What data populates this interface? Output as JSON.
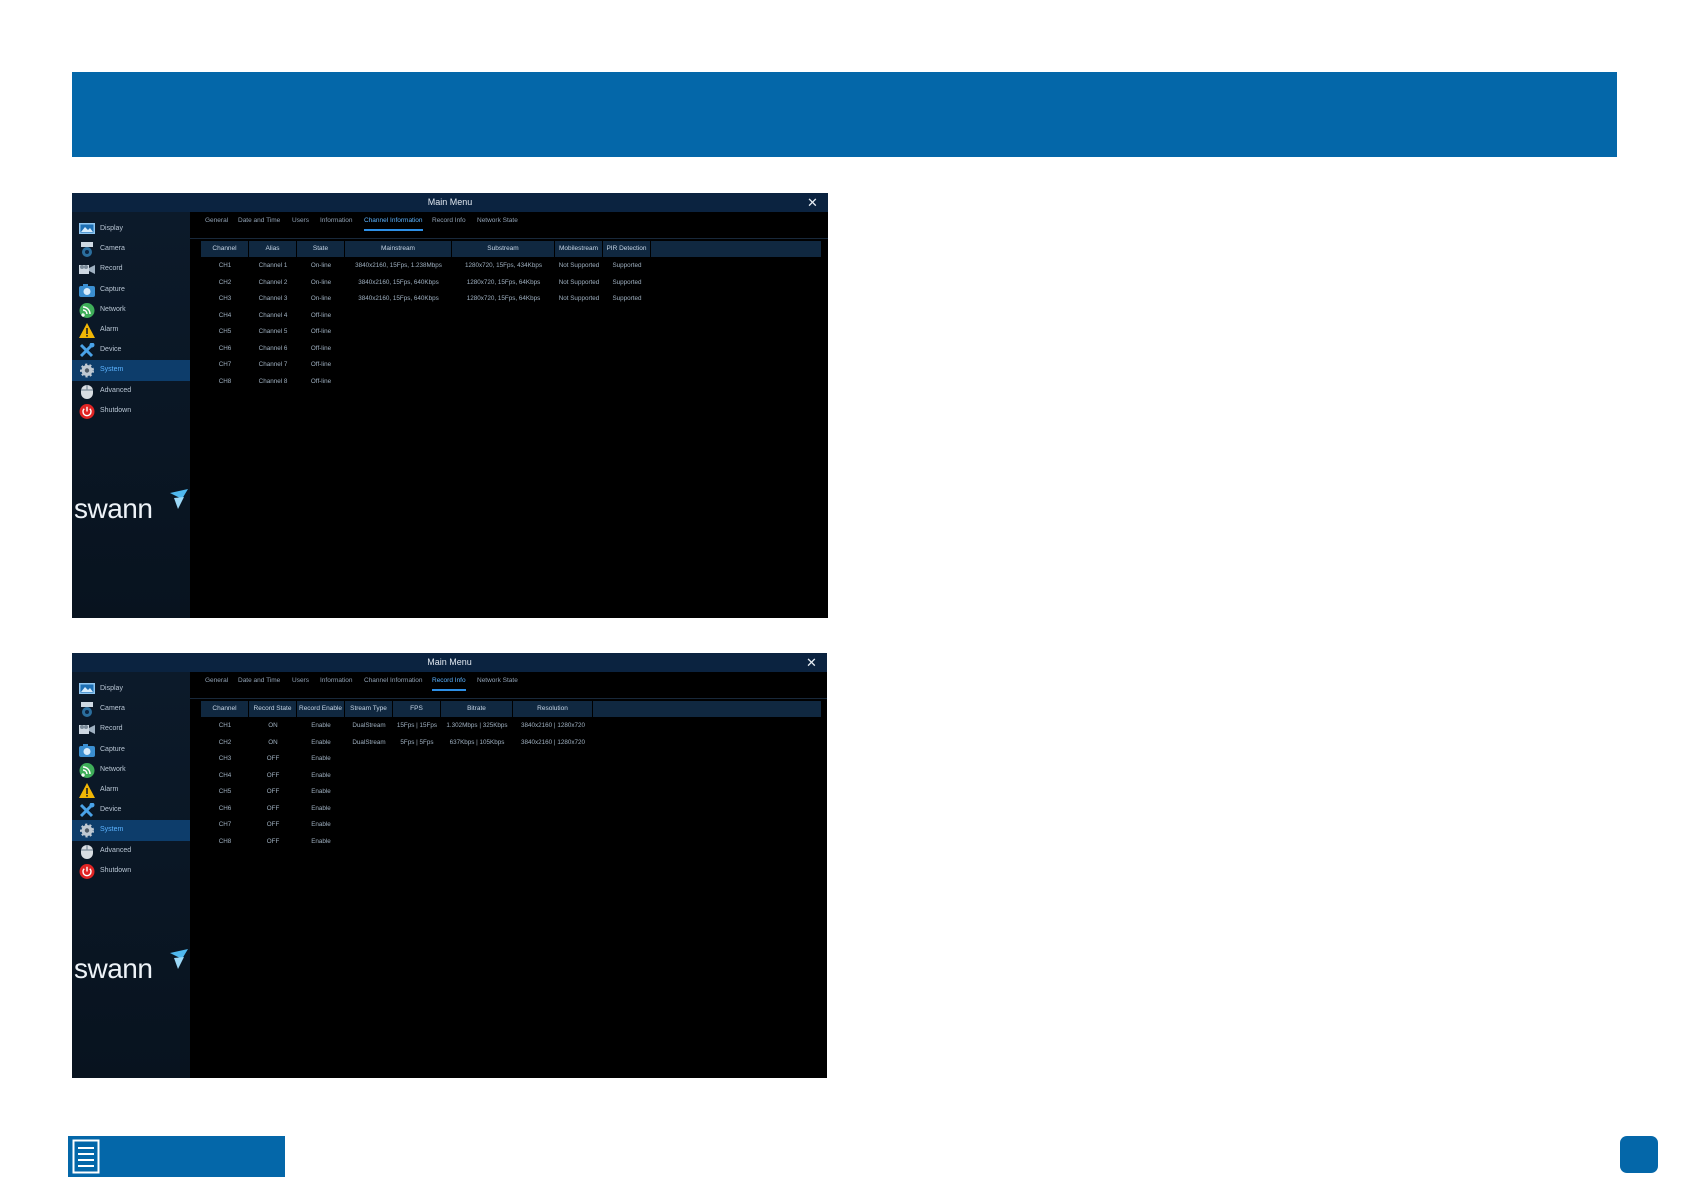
{
  "colors": {
    "brand_blue": "#0467a9",
    "menu_dark": "#0b2340",
    "active_tab": "#5cb3ff"
  },
  "logo_text": "swann",
  "window_title": "Main Menu",
  "sidebar": [
    {
      "label": "Display",
      "icon": "display-icon"
    },
    {
      "label": "Camera",
      "icon": "camera-icon"
    },
    {
      "label": "Record",
      "icon": "record-icon"
    },
    {
      "label": "Capture",
      "icon": "capture-icon"
    },
    {
      "label": "Network",
      "icon": "network-icon"
    },
    {
      "label": "Alarm",
      "icon": "alarm-icon"
    },
    {
      "label": "Device",
      "icon": "device-icon"
    },
    {
      "label": "System",
      "icon": "gear-icon",
      "active": true
    },
    {
      "label": "Advanced",
      "icon": "advanced-icon"
    },
    {
      "label": "Shutdown",
      "icon": "power-icon"
    }
  ],
  "tabs": [
    "General",
    "Date and Time",
    "Users",
    "Information",
    "Channel Information",
    "Record Info",
    "Network State"
  ],
  "screen1": {
    "active_tab": "Channel Information",
    "columns": [
      "Channel",
      "Alias",
      "State",
      "Mainstream",
      "Substream",
      "Mobilestream",
      "PIR Detection"
    ],
    "rows": [
      [
        "CH1",
        "Channel 1",
        "On-line",
        "3840x2160, 15Fps, 1.238Mbps",
        "1280x720, 15Fps, 434Kbps",
        "Not Supported",
        "Supported"
      ],
      [
        "CH2",
        "Channel 2",
        "On-line",
        "3840x2160, 15Fps, 640Kbps",
        "1280x720, 15Fps, 64Kbps",
        "Not Supported",
        "Supported"
      ],
      [
        "CH3",
        "Channel 3",
        "On-line",
        "3840x2160, 15Fps, 640Kbps",
        "1280x720, 15Fps, 64Kbps",
        "Not Supported",
        "Supported"
      ],
      [
        "CH4",
        "Channel 4",
        "Off-line",
        "",
        "",
        "",
        ""
      ],
      [
        "CH5",
        "Channel 5",
        "Off-line",
        "",
        "",
        "",
        ""
      ],
      [
        "CH6",
        "Channel 6",
        "Off-line",
        "",
        "",
        "",
        ""
      ],
      [
        "CH7",
        "Channel 7",
        "Off-line",
        "",
        "",
        "",
        ""
      ],
      [
        "CH8",
        "Channel 8",
        "Off-line",
        "",
        "",
        "",
        ""
      ]
    ]
  },
  "screen2": {
    "active_tab": "Record Info",
    "columns": [
      "Channel",
      "Record State",
      "Record Enable",
      "Stream Type",
      "FPS",
      "Bitrate",
      "Resolution"
    ],
    "rows": [
      [
        "CH1",
        "ON",
        "Enable",
        "DualStream",
        "15Fps | 15Fps",
        "1.302Mbps | 325Kbps",
        "3840x2160 | 1280x720"
      ],
      [
        "CH2",
        "ON",
        "Enable",
        "DualStream",
        "5Fps | 5Fps",
        "637Kbps | 105Kbps",
        "3840x2160 | 1280x720"
      ],
      [
        "CH3",
        "OFF",
        "Enable",
        "",
        "",
        "",
        ""
      ],
      [
        "CH4",
        "OFF",
        "Enable",
        "",
        "",
        "",
        ""
      ],
      [
        "CH5",
        "OFF",
        "Enable",
        "",
        "",
        "",
        ""
      ],
      [
        "CH6",
        "OFF",
        "Enable",
        "",
        "",
        "",
        ""
      ],
      [
        "CH7",
        "OFF",
        "Enable",
        "",
        "",
        "",
        ""
      ],
      [
        "CH8",
        "OFF",
        "Enable",
        "",
        "",
        "",
        ""
      ]
    ]
  }
}
